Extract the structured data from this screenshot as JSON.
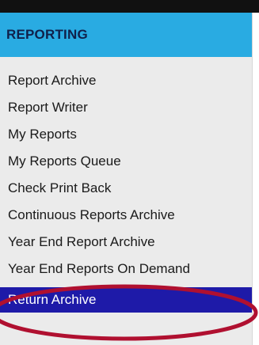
{
  "menu": {
    "header": "REPORTING",
    "items": [
      {
        "label": "Report Archive"
      },
      {
        "label": "Report Writer"
      },
      {
        "label": "My Reports"
      },
      {
        "label": "My Reports Queue"
      },
      {
        "label": "Check Print Back"
      },
      {
        "label": "Continuous Reports Archive"
      },
      {
        "label": "Year End Report Archive"
      },
      {
        "label": "Year End Reports On Demand"
      },
      {
        "label": "Return Archive"
      }
    ],
    "active_index": 8
  },
  "colors": {
    "header_bg": "#29abe2",
    "panel_bg": "#ebebeb",
    "active_bg": "#1e1aa8",
    "annotation": "#b01030"
  }
}
